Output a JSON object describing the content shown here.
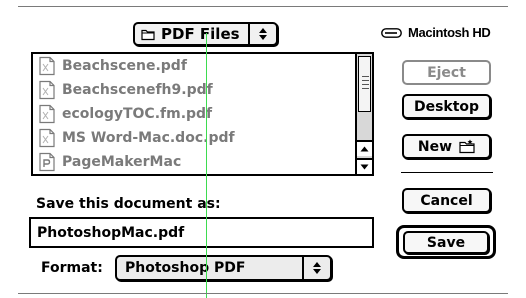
{
  "dialog": {
    "folder_popup": {
      "label": "PDF Files",
      "icon": "folder-icon"
    },
    "disk": {
      "label": "Macintosh HD",
      "icon": "hard-disk-icon"
    },
    "file_list": {
      "items": [
        {
          "name": "Beachscene.pdf",
          "icon": "pdf-document-icon"
        },
        {
          "name": "Beachscenefh9.pdf",
          "icon": "pdf-document-icon"
        },
        {
          "name": "ecologyTOC.fm.pdf",
          "icon": "pdf-document-icon"
        },
        {
          "name": "MS Word-Mac.doc.pdf",
          "icon": "pdf-document-icon"
        },
        {
          "name": "PageMakerMac",
          "icon": "pagemaker-document-icon"
        }
      ]
    },
    "buttons": {
      "eject": "Eject",
      "desktop": "Desktop",
      "new": "New",
      "cancel": "Cancel",
      "save": "Save"
    },
    "save_prompt": "Save this document as:",
    "filename_value": "PhotoshopMac.pdf",
    "format": {
      "label": "Format:",
      "selected": "Photoshop PDF"
    },
    "colors": {
      "disabled_text": "#7a7a7a",
      "guide_line": "#3ddc4f"
    }
  }
}
